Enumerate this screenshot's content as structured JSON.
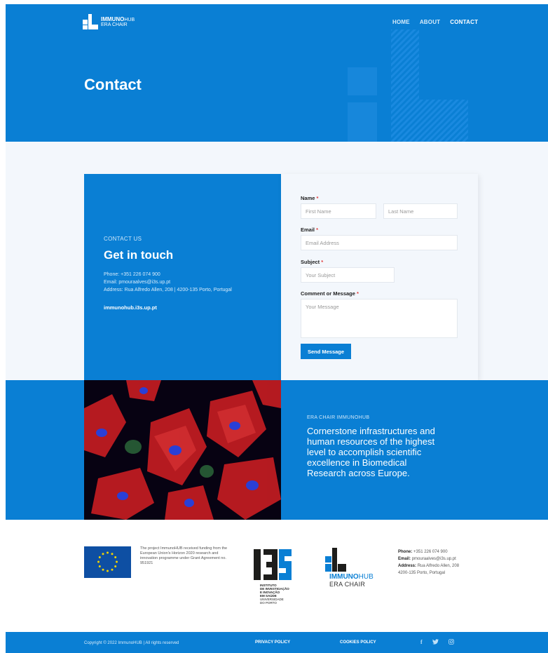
{
  "header": {
    "logo_bold": "IMMUNO",
    "logo_light": "HUB",
    "logo_sub": "ERA CHAIR",
    "nav": [
      {
        "label": "HOME"
      },
      {
        "label": "ABOUT"
      },
      {
        "label": "CONTACT"
      }
    ],
    "page_title": "Contact"
  },
  "contact_info": {
    "eyebrow": "CONTACT US",
    "heading": "Get in touch",
    "phone": "Phone: +351 226 074 900",
    "email": "Email: pmouraalves@i3s.up.pt",
    "address": "Address: Rua Alfredo Allen, 208 | 4200-135 Porto, Portugal",
    "website": "immunohub.i3s.up.pt"
  },
  "form": {
    "name_label": "Name",
    "required_mark": "*",
    "first_name_placeholder": "First Name",
    "last_name_placeholder": "Last Name",
    "email_label": "Email",
    "email_placeholder": "Email Address",
    "subject_label": "Subject",
    "subject_placeholder": "Your Subject",
    "message_label": "Comment or Message",
    "message_placeholder": "Your Message",
    "submit_label": "Send Message"
  },
  "band": {
    "eyebrow": "ERA CHAIR IMMUNOHUB",
    "quote": "Cornerstone infrastructures and human resources of the highest level to accomplish scientific excellence in Biomedical Research across Europe."
  },
  "footer": {
    "eu_text": "The project ImmunoHUB received funding from the European Union's Horizon 2020 research and innovation programme under Grant Agreement no. 951921",
    "i3s_caption": [
      "INSTITUTO",
      "DE INVESTIGAÇÃO",
      "E INOVAÇÃO",
      "EM SAÚDE",
      "UNIVERSIDADE",
      "DO PORTO"
    ],
    "logo_bold": "IMMUNO",
    "logo_light": "HUB",
    "logo_sub": "ERA CHAIR",
    "phone_label": "Phone:",
    "phone": "+351 226 074 900",
    "email_label": "Email:",
    "email": "pmouraalves@i3s.up.pt",
    "address_label": "Address:",
    "address_1": "Rua Alfredo Allen, 208",
    "address_2": "4200-135 Porto, Portugal",
    "copyright": "Copyright © 2022 ImmunoHUB | All rights reserved",
    "privacy": "PRIVACY POLICY",
    "cookies": "COOKIES POLICY",
    "social": [
      "facebook-icon",
      "twitter-icon",
      "instagram-icon"
    ]
  },
  "colors": {
    "primary": "#0a7fd4",
    "light_bg": "#f3f7fc",
    "required": "#e23b3b"
  }
}
